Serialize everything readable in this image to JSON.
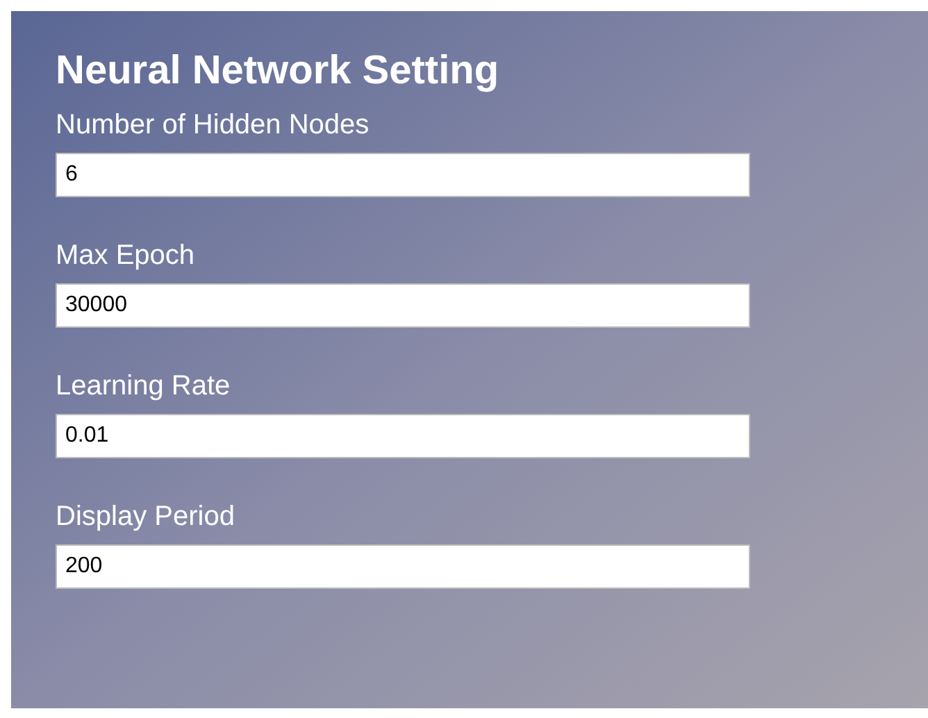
{
  "title": "Neural Network Setting",
  "fields": [
    {
      "label": "Number of Hidden Nodes",
      "value": "6"
    },
    {
      "label": "Max Epoch",
      "value": "30000"
    },
    {
      "label": "Learning Rate",
      "value": "0.01"
    },
    {
      "label": "Display Period",
      "value": "200"
    }
  ]
}
